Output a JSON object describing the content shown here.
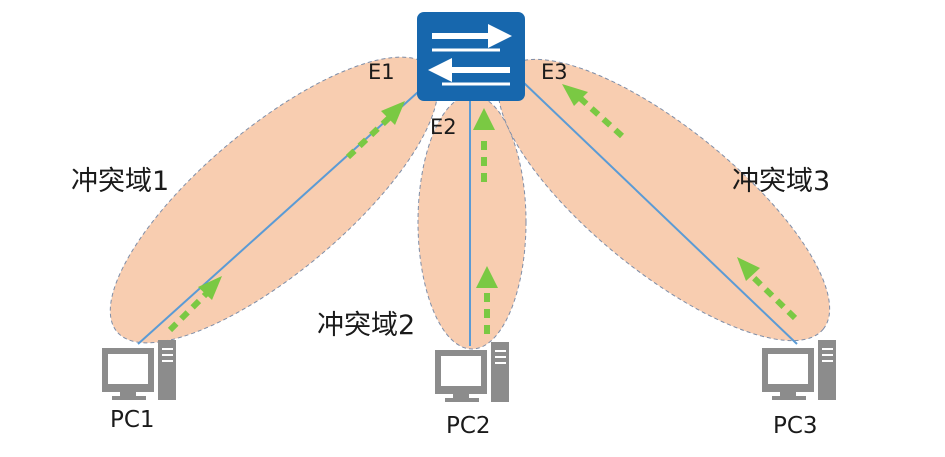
{
  "colors": {
    "domain_fill": "#f8cdb0",
    "domain_stroke": "#7f8ea8",
    "link": "#5b9bd5",
    "arrow": "#7ac943",
    "switch_fill": "#1767ad",
    "pc_gray": "#8c8c8c"
  },
  "switch": {
    "icon": "switch-icon"
  },
  "ports": {
    "e1": "E1",
    "e2": "E2",
    "e3": "E3"
  },
  "domains": {
    "d1": "冲突域1",
    "d2": "冲突域2",
    "d3": "冲突域3"
  },
  "pcs": {
    "pc1": "PC1",
    "pc2": "PC2",
    "pc3": "PC3"
  }
}
